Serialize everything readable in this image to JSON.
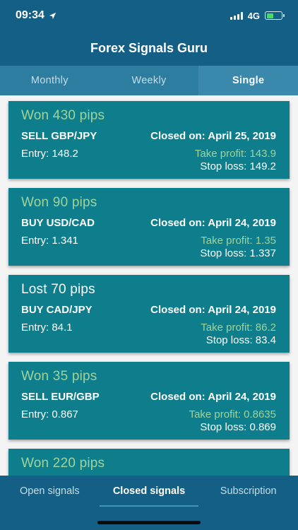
{
  "status_bar": {
    "time": "09:34",
    "network": "4G",
    "location_icon": "location-arrow-icon",
    "battery_level": 0.45
  },
  "header": {
    "title": "Forex Signals Guru"
  },
  "tabs": [
    {
      "label": "Monthly",
      "active": false
    },
    {
      "label": "Weekly",
      "active": false
    },
    {
      "label": "Single",
      "active": true
    }
  ],
  "signals": [
    {
      "result": "Won 430 pips",
      "outcome": "won",
      "pair": "SELL GBP/JPY",
      "closed": "Closed on: April 25, 2019",
      "entry": "Entry: 148.2",
      "take_profit": "Take profit: 143.9",
      "stop_loss": "Stop loss: 149.2"
    },
    {
      "result": "Won 90 pips",
      "outcome": "won",
      "pair": "BUY USD/CAD",
      "closed": "Closed on: April 24, 2019",
      "entry": "Entry: 1.341",
      "take_profit": "Take profit: 1.35",
      "stop_loss": "Stop loss: 1.337"
    },
    {
      "result": "Lost 70 pips",
      "outcome": "lost",
      "pair": "BUY CAD/JPY",
      "closed": "Closed on: April 24, 2019",
      "entry": "Entry: 84.1",
      "take_profit": "Take profit: 86.2",
      "stop_loss": "Stop loss: 83.4"
    },
    {
      "result": "Won 35 pips",
      "outcome": "won",
      "pair": "SELL EUR/GBP",
      "closed": "Closed on: April 24, 2019",
      "entry": "Entry: 0.867",
      "take_profit": "Take profit: 0.8635",
      "stop_loss": "Stop loss: 0.869"
    },
    {
      "result": "Won 220 pips",
      "outcome": "won"
    }
  ],
  "bottom_nav": [
    {
      "label": "Open signals",
      "active": false
    },
    {
      "label": "Closed signals",
      "active": true
    },
    {
      "label": "Subscription",
      "active": false
    }
  ],
  "colors": {
    "primary": "#145f86",
    "tab_bar": "#2d7da1",
    "card": "#0e7e8d",
    "won_green": "#9ed39a"
  }
}
